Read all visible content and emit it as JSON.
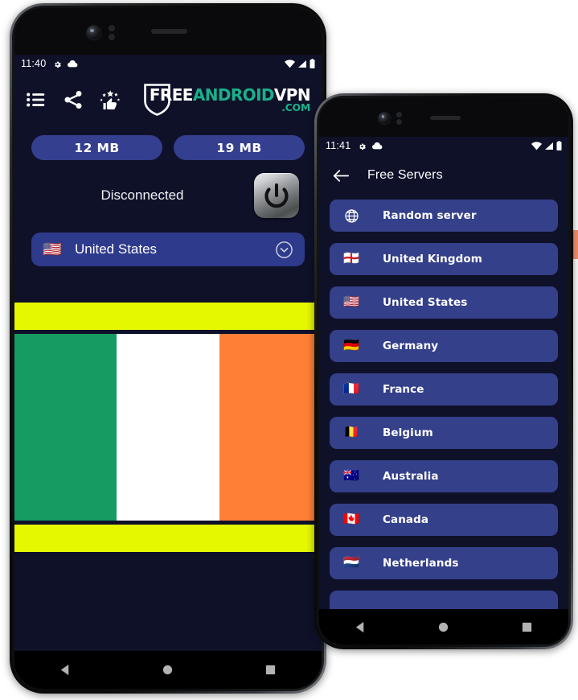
{
  "meta": {
    "bg_color": "#ffffff",
    "app_bg": "#0f1129",
    "card_blue": "#34408a",
    "pill_blue": "#343f8f",
    "accent_teal": "#19b08a",
    "ad_yellow": "#e5f800"
  },
  "phone1": {
    "status_bar": {
      "time": "11:40",
      "left_icons": [
        "gear-icon",
        "cloud-icon"
      ],
      "right_icons": [
        "wifi-icon",
        "signal-icon",
        "battery-icon"
      ]
    },
    "toolbar": {
      "icons": [
        {
          "name": "list-menu-icon",
          "label": "Servers list"
        },
        {
          "name": "share-icon",
          "label": "Share"
        },
        {
          "name": "rate-thumbs-up-icon",
          "label": "Rate app"
        }
      ],
      "logo": {
        "word1": "FREE",
        "word2": "ANDROID",
        "word3": "VPN",
        "word4": ".COM",
        "word1_color": "#ffffff",
        "word2_color": "#19b08a",
        "word3_color": "#ffffff",
        "word4_color": "#19b08a"
      }
    },
    "traffic": {
      "download_label": "12 MB",
      "upload_label": "19 MB"
    },
    "connection": {
      "status_text": "Disconnected",
      "power_button_label": "power-toggle"
    },
    "server_selector": {
      "flag": "🇺🇸",
      "country": "United States",
      "chevron": "chevron-down-circle-icon"
    },
    "advertisement": {
      "type": "banner",
      "top_bar_color": "#e5f800",
      "bottom_bar_color": "#e5f800",
      "image": "ireland-flag",
      "stripes": [
        "#169b62",
        "#ffffff",
        "#ff7f36"
      ]
    },
    "nav_bar": {
      "buttons": [
        "back-triangle-icon",
        "home-circle-icon",
        "recents-square-icon"
      ]
    }
  },
  "phone2": {
    "status_bar": {
      "time": "11:41",
      "left_icons": [
        "gear-icon",
        "cloud-icon"
      ],
      "right_icons": [
        "wifi-icon",
        "signal-icon",
        "battery-icon"
      ]
    },
    "app_bar": {
      "back_icon": "back-arrow-icon",
      "title": "Free Servers"
    },
    "servers": [
      {
        "flag": "globe",
        "name": "Random server"
      },
      {
        "flag": "🏴󠁧󠁢󠁥󠁮󠁧󠁿",
        "name": "United Kingdom"
      },
      {
        "flag": "🇺🇸",
        "name": "United States"
      },
      {
        "flag": "🇩🇪",
        "name": "Germany"
      },
      {
        "flag": "🇫🇷",
        "name": "France"
      },
      {
        "flag": "🇧🇪",
        "name": "Belgium"
      },
      {
        "flag": "🇦🇺",
        "name": "Australia"
      },
      {
        "flag": "🇨🇦",
        "name": "Canada"
      },
      {
        "flag": "🇳🇱",
        "name": "Netherlands"
      },
      {
        "flag": "",
        "name": ""
      }
    ],
    "nav_bar": {
      "buttons": [
        "back-triangle-icon",
        "home-circle-icon",
        "recents-square-icon"
      ]
    }
  }
}
